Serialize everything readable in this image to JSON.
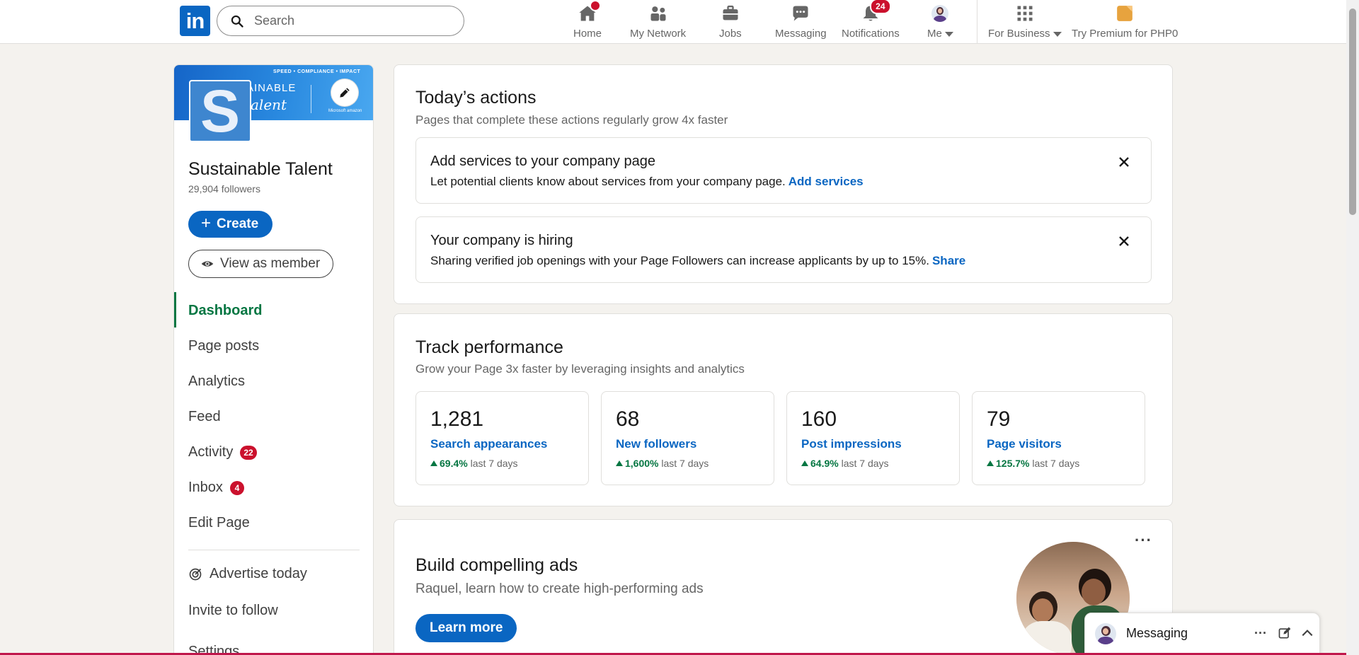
{
  "nav": {
    "logo_text": "in",
    "search_placeholder": "Search",
    "items": [
      {
        "label": "Home",
        "badge": ""
      },
      {
        "label": "My Network",
        "badge": ""
      },
      {
        "label": "Jobs",
        "badge": ""
      },
      {
        "label": "Messaging",
        "badge": ""
      },
      {
        "label": "Notifications",
        "badge": "24"
      },
      {
        "label": "Me",
        "badge": ""
      },
      {
        "label": "For Business",
        "badge": ""
      },
      {
        "label": "Try Premium for PHP0",
        "badge": ""
      }
    ]
  },
  "page": {
    "banner_tag": "SPEED • COMPLIANCE • IMPACT",
    "banner_big": "AINABLE",
    "banner_script": "alent",
    "banner_logos": "Microsoft  amazon",
    "avatar_letter": "S",
    "name": "Sustainable Talent",
    "followers": "29,904 followers",
    "create_label": "Create",
    "view_member_label": "View as member"
  },
  "menu": {
    "dashboard": "Dashboard",
    "page_posts": "Page posts",
    "analytics": "Analytics",
    "feed": "Feed",
    "activity": "Activity",
    "activity_badge": "22",
    "inbox": "Inbox",
    "inbox_badge": "4",
    "edit_page": "Edit Page",
    "advertise": "Advertise today",
    "invite": "Invite to follow",
    "settings": "Settings"
  },
  "actions": {
    "title": "Today’s actions",
    "subtitle": "Pages that complete these actions regularly grow 4x faster",
    "items": [
      {
        "title": "Add services to your company page",
        "desc": "Let potential clients know about services from your company page.",
        "link": "Add services"
      },
      {
        "title": "Your company is hiring",
        "desc": "Sharing verified job openings with your Page Followers can increase applicants by up to 15%.",
        "link": "Share"
      }
    ]
  },
  "performance": {
    "title": "Track performance",
    "subtitle": "Grow your Page 3x faster by leveraging insights and analytics",
    "metrics": [
      {
        "value": "1,281",
        "label": "Search appearances",
        "pct": "69.4%",
        "period": "last 7 days"
      },
      {
        "value": "68",
        "label": "New followers",
        "pct": "1,600%",
        "period": "last 7 days"
      },
      {
        "value": "160",
        "label": "Post impressions",
        "pct": "64.9%",
        "period": "last 7 days"
      },
      {
        "value": "79",
        "label": "Page visitors",
        "pct": "125.7%",
        "period": "last 7 days"
      }
    ]
  },
  "ads": {
    "title": "Build compelling ads",
    "subtitle": "Raquel, learn how to create high-performing ads",
    "button": "Learn more",
    "more": "···"
  },
  "messaging_dock": {
    "title": "Messaging",
    "more": "···"
  },
  "colors": {
    "brand": "#0a66c2",
    "active_green": "#057642",
    "badge_red": "#cb112d"
  }
}
